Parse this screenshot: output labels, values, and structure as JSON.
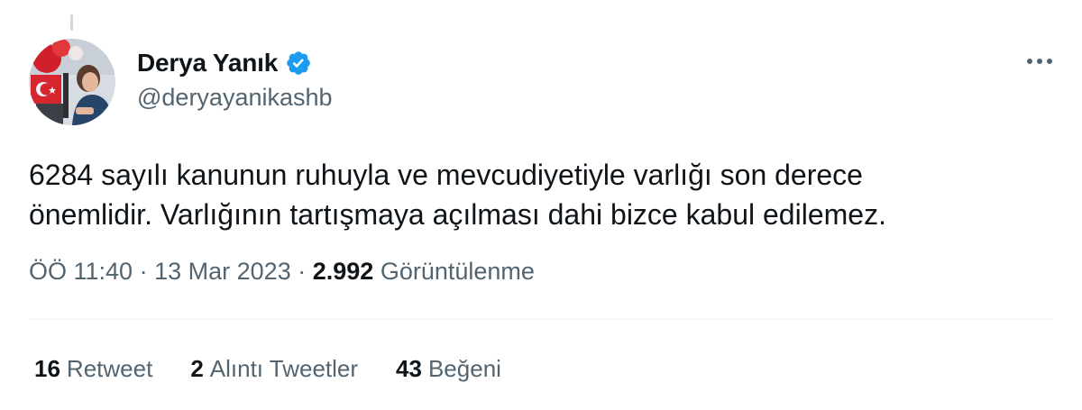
{
  "tweet": {
    "author": {
      "name": "Derya Yanık",
      "handle": "@deryayanikashb",
      "verified_icon": "verified-badge-icon",
      "avatar_icon": "profile-avatar"
    },
    "more_icon": "more-options-icon",
    "text_lines": [
      "6284 sayılı kanunun ruhuyla ve mevcudiyetiyle varlığı son derece",
      "önemlidir. Varlığının tartışmaya açılması dahi bizce kabul edilemez."
    ],
    "meta": {
      "time": "ÖÖ 11:40",
      "separator": "·",
      "date": "13 Mar 2023",
      "views_count": "2.992",
      "views_label": "Görüntülenme"
    },
    "stats": {
      "retweets": {
        "count": "16",
        "label": "Retweet"
      },
      "quotes": {
        "count": "2",
        "label": "Alıntı Tweetler"
      },
      "likes": {
        "count": "43",
        "label": "Beğeni"
      }
    }
  },
  "colors": {
    "text_primary": "#0f1419",
    "text_secondary": "#536471",
    "verified_blue": "#1d9bf0",
    "divider": "#eff3f4"
  }
}
